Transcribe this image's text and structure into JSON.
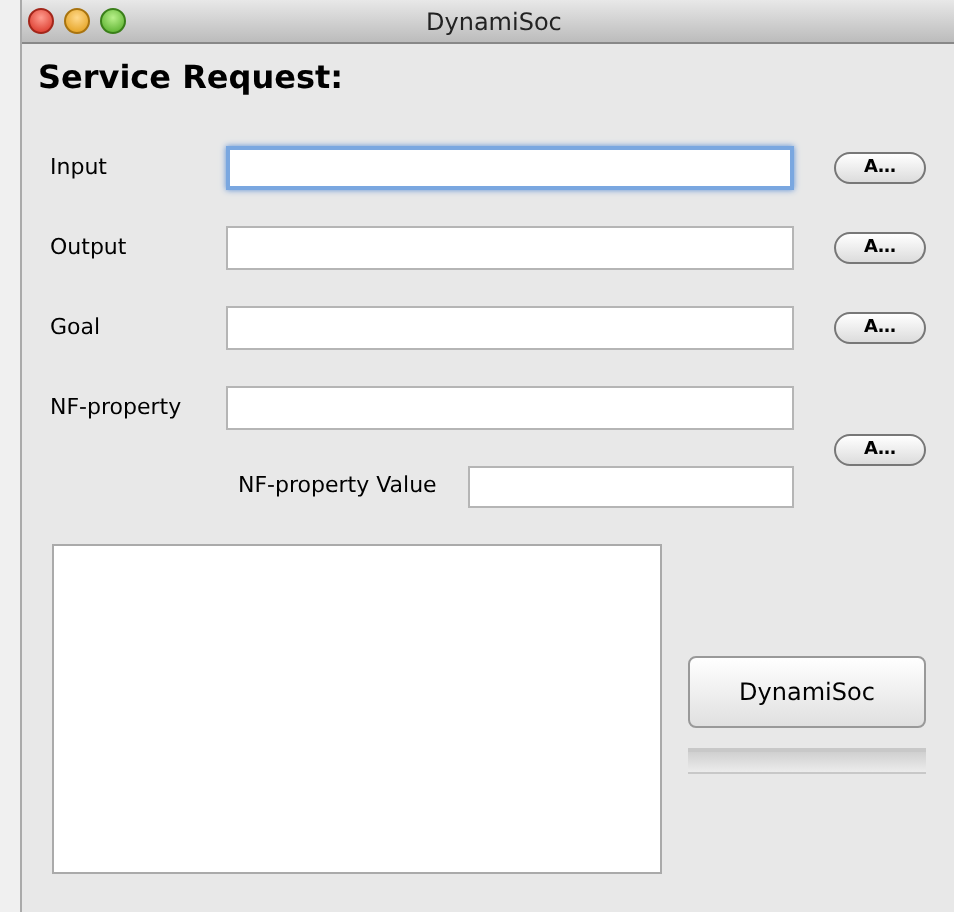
{
  "window": {
    "title": "DynamiSoc"
  },
  "heading": "Service Request:",
  "fields": [
    {
      "label": "Input",
      "focused": true,
      "button": "A…"
    },
    {
      "label": "Output",
      "focused": false,
      "button": "A…"
    },
    {
      "label": "Goal",
      "focused": false,
      "button": "A…"
    }
  ],
  "nf_property": {
    "label": "NF-property",
    "button": "A…",
    "value_label": "NF-property Value"
  },
  "run_button": "DynamiSoc",
  "progress": {
    "level": 0
  }
}
